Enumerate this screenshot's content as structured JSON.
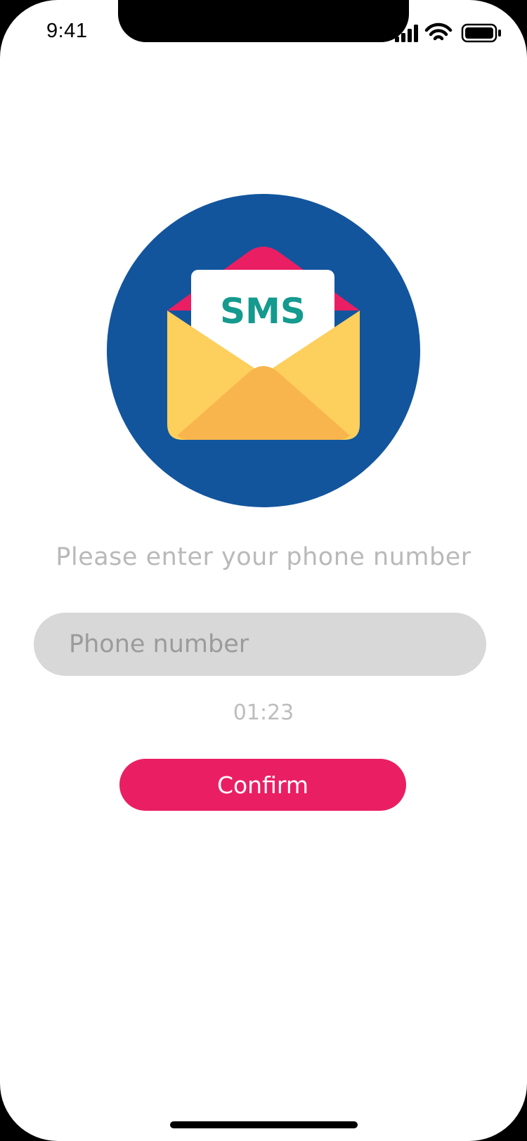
{
  "status_bar": {
    "time": "9:41",
    "icons": [
      "cellular-signal-icon",
      "wifi-icon",
      "battery-icon"
    ]
  },
  "hero": {
    "icon": "sms-envelope-icon",
    "badge_text": "SMS",
    "colors": {
      "circle": "#12559d",
      "envelope_body": "#fdcf5c",
      "envelope_flap": "#f8b54e",
      "envelope_back": "#e91e63",
      "letter": "#ffffff",
      "badge_text": "#149a8e"
    }
  },
  "prompt": "Please enter your phone number",
  "phone_input": {
    "placeholder": "Phone number",
    "value": ""
  },
  "timer": "01:23",
  "confirm_button": {
    "label": "Confirm",
    "color": "#ea1f63"
  }
}
